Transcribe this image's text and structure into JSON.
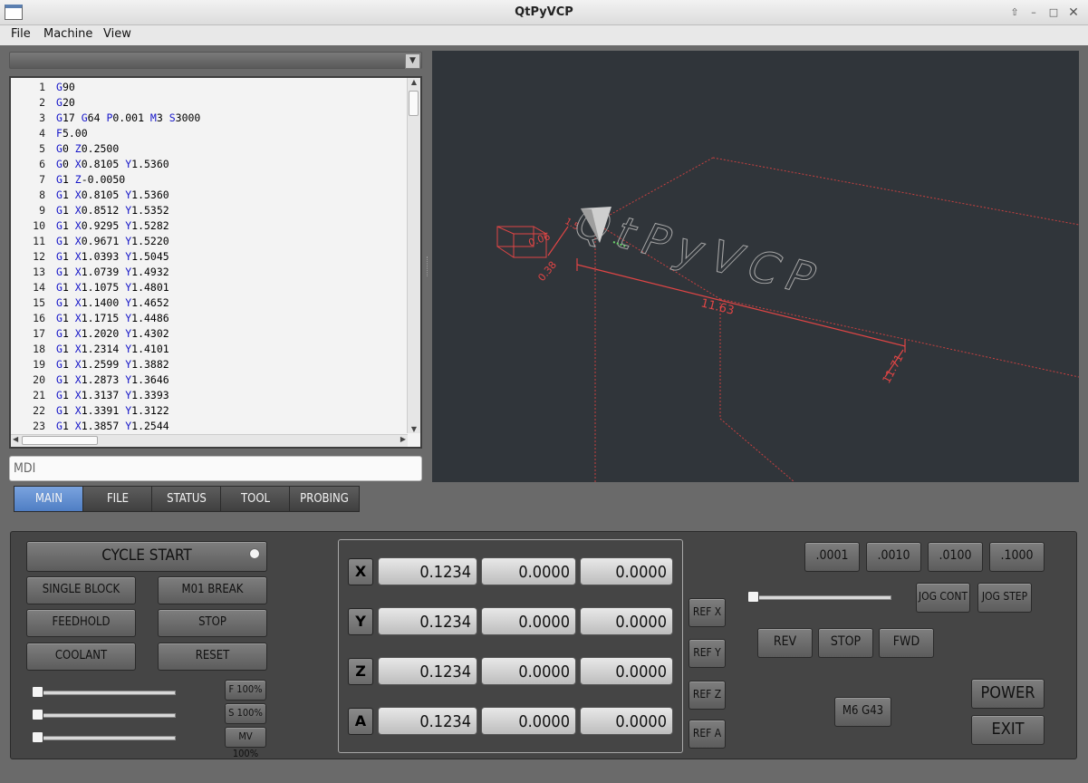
{
  "window": {
    "title": "QtPyVCP"
  },
  "menu": [
    "File",
    "Machine",
    "View"
  ],
  "program": {
    "lines": [
      {
        "n": "1",
        "parts": [
          [
            "k",
            "G"
          ],
          [
            "w",
            "90"
          ]
        ]
      },
      {
        "n": "2",
        "parts": [
          [
            "k",
            "G"
          ],
          [
            "w",
            "20"
          ]
        ]
      },
      {
        "n": "3",
        "parts": [
          [
            "k",
            "G"
          ],
          [
            "w",
            "17 "
          ],
          [
            "k",
            "G"
          ],
          [
            "w",
            "64 "
          ],
          [
            "k",
            "P"
          ],
          [
            "w",
            "0.001 "
          ],
          [
            "k",
            "M"
          ],
          [
            "w",
            "3 "
          ],
          [
            "k",
            "S"
          ],
          [
            "w",
            "3000"
          ]
        ]
      },
      {
        "n": "4",
        "parts": [
          [
            "k",
            "F"
          ],
          [
            "w",
            "5.00"
          ]
        ]
      },
      {
        "n": "5",
        "parts": [
          [
            "k",
            "G"
          ],
          [
            "w",
            "0 "
          ],
          [
            "k",
            "Z"
          ],
          [
            "w",
            "0.2500"
          ]
        ]
      },
      {
        "n": "6",
        "parts": [
          [
            "k",
            "G"
          ],
          [
            "w",
            "0 "
          ],
          [
            "k",
            "X"
          ],
          [
            "w",
            "0.8105 "
          ],
          [
            "k",
            "Y"
          ],
          [
            "w",
            "1.5360"
          ]
        ]
      },
      {
        "n": "7",
        "parts": [
          [
            "k",
            "G"
          ],
          [
            "w",
            "1 "
          ],
          [
            "k",
            "Z"
          ],
          [
            "w",
            "-0.0050"
          ]
        ]
      },
      {
        "n": "8",
        "parts": [
          [
            "k",
            "G"
          ],
          [
            "w",
            "1 "
          ],
          [
            "k",
            "X"
          ],
          [
            "w",
            "0.8105 "
          ],
          [
            "k",
            "Y"
          ],
          [
            "w",
            "1.5360"
          ]
        ]
      },
      {
        "n": "9",
        "parts": [
          [
            "k",
            "G"
          ],
          [
            "w",
            "1 "
          ],
          [
            "k",
            "X"
          ],
          [
            "w",
            "0.8512 "
          ],
          [
            "k",
            "Y"
          ],
          [
            "w",
            "1.5352"
          ]
        ]
      },
      {
        "n": "10",
        "parts": [
          [
            "k",
            "G"
          ],
          [
            "w",
            "1 "
          ],
          [
            "k",
            "X"
          ],
          [
            "w",
            "0.9295 "
          ],
          [
            "k",
            "Y"
          ],
          [
            "w",
            "1.5282"
          ]
        ]
      },
      {
        "n": "11",
        "parts": [
          [
            "k",
            "G"
          ],
          [
            "w",
            "1 "
          ],
          [
            "k",
            "X"
          ],
          [
            "w",
            "0.9671 "
          ],
          [
            "k",
            "Y"
          ],
          [
            "w",
            "1.5220"
          ]
        ]
      },
      {
        "n": "12",
        "parts": [
          [
            "k",
            "G"
          ],
          [
            "w",
            "1 "
          ],
          [
            "k",
            "X"
          ],
          [
            "w",
            "1.0393 "
          ],
          [
            "k",
            "Y"
          ],
          [
            "w",
            "1.5045"
          ]
        ]
      },
      {
        "n": "13",
        "parts": [
          [
            "k",
            "G"
          ],
          [
            "w",
            "1 "
          ],
          [
            "k",
            "X"
          ],
          [
            "w",
            "1.0739 "
          ],
          [
            "k",
            "Y"
          ],
          [
            "w",
            "1.4932"
          ]
        ]
      },
      {
        "n": "14",
        "parts": [
          [
            "k",
            "G"
          ],
          [
            "w",
            "1 "
          ],
          [
            "k",
            "X"
          ],
          [
            "w",
            "1.1075 "
          ],
          [
            "k",
            "Y"
          ],
          [
            "w",
            "1.4801"
          ]
        ]
      },
      {
        "n": "15",
        "parts": [
          [
            "k",
            "G"
          ],
          [
            "w",
            "1 "
          ],
          [
            "k",
            "X"
          ],
          [
            "w",
            "1.1400 "
          ],
          [
            "k",
            "Y"
          ],
          [
            "w",
            "1.4652"
          ]
        ]
      },
      {
        "n": "16",
        "parts": [
          [
            "k",
            "G"
          ],
          [
            "w",
            "1 "
          ],
          [
            "k",
            "X"
          ],
          [
            "w",
            "1.1715 "
          ],
          [
            "k",
            "Y"
          ],
          [
            "w",
            "1.4486"
          ]
        ]
      },
      {
        "n": "17",
        "parts": [
          [
            "k",
            "G"
          ],
          [
            "w",
            "1 "
          ],
          [
            "k",
            "X"
          ],
          [
            "w",
            "1.2020 "
          ],
          [
            "k",
            "Y"
          ],
          [
            "w",
            "1.4302"
          ]
        ]
      },
      {
        "n": "18",
        "parts": [
          [
            "k",
            "G"
          ],
          [
            "w",
            "1 "
          ],
          [
            "k",
            "X"
          ],
          [
            "w",
            "1.2314 "
          ],
          [
            "k",
            "Y"
          ],
          [
            "w",
            "1.4101"
          ]
        ]
      },
      {
        "n": "19",
        "parts": [
          [
            "k",
            "G"
          ],
          [
            "w",
            "1 "
          ],
          [
            "k",
            "X"
          ],
          [
            "w",
            "1.2599 "
          ],
          [
            "k",
            "Y"
          ],
          [
            "w",
            "1.3882"
          ]
        ]
      },
      {
        "n": "20",
        "parts": [
          [
            "k",
            "G"
          ],
          [
            "w",
            "1 "
          ],
          [
            "k",
            "X"
          ],
          [
            "w",
            "1.2873 "
          ],
          [
            "k",
            "Y"
          ],
          [
            "w",
            "1.3646"
          ]
        ]
      },
      {
        "n": "21",
        "parts": [
          [
            "k",
            "G"
          ],
          [
            "w",
            "1 "
          ],
          [
            "k",
            "X"
          ],
          [
            "w",
            "1.3137 "
          ],
          [
            "k",
            "Y"
          ],
          [
            "w",
            "1.3393"
          ]
        ]
      },
      {
        "n": "22",
        "parts": [
          [
            "k",
            "G"
          ],
          [
            "w",
            "1 "
          ],
          [
            "k",
            "X"
          ],
          [
            "w",
            "1.3391 "
          ],
          [
            "k",
            "Y"
          ],
          [
            "w",
            "1.3122"
          ]
        ]
      },
      {
        "n": "23",
        "parts": [
          [
            "k",
            "G"
          ],
          [
            "w",
            "1 "
          ],
          [
            "k",
            "X"
          ],
          [
            "w",
            "1.3857 "
          ],
          [
            "k",
            "Y"
          ],
          [
            "w",
            "1.2544"
          ]
        ]
      }
    ]
  },
  "mdi": {
    "placeholder": "MDI"
  },
  "backplot": {
    "watermark": "QtPyVCP",
    "dims": {
      "x_len": "11.63",
      "y_len": "11.71",
      "left_a": "0.38",
      "left_b": "1.5",
      "left_c": "0.06"
    },
    "colors": {
      "bg": "#30353a",
      "limits": "#d23a3a",
      "text_outline": "#9a9a9a",
      "tool": "#cfcfcf"
    }
  },
  "tabs": [
    {
      "label": "MAIN",
      "selected": true
    },
    {
      "label": "FILE",
      "selected": false
    },
    {
      "label": "STATUS",
      "selected": false
    },
    {
      "label": "TOOL",
      "selected": false
    },
    {
      "label": "PROBING",
      "selected": false
    }
  ],
  "controls": {
    "cycle_start": "CYCLE START",
    "single_block": "SINGLE BLOCK",
    "m01_break": "M01 BREAK",
    "feedhold": "FEEDHOLD",
    "stop": "STOP",
    "coolant": "COOLANT",
    "reset": "RESET",
    "feed_override": "F 100%",
    "spindle_override": "S 100%",
    "max_velocity": "MV 100%",
    "feed_override_value": 0,
    "spindle_override_value": 0,
    "max_velocity_value": 0
  },
  "dro": [
    {
      "axis": "X",
      "values": [
        "0.1234",
        "0.0000",
        "0.0000"
      ],
      "ref": "REF X"
    },
    {
      "axis": "Y",
      "values": [
        "0.1234",
        "0.0000",
        "0.0000"
      ],
      "ref": "REF Y"
    },
    {
      "axis": "Z",
      "values": [
        "0.1234",
        "0.0000",
        "0.0000"
      ],
      "ref": "REF Z"
    },
    {
      "axis": "A",
      "values": [
        "0.1234",
        "0.0000",
        "0.0000"
      ],
      "ref": "REF A"
    }
  ],
  "jog": {
    "increments": [
      ".0001",
      ".0010",
      ".0100",
      ".1000"
    ],
    "jog_cont": "JOG CONT",
    "jog_step": "JOG STEP",
    "jog_speed_value": 0,
    "rev": "REV",
    "stop": "STOP",
    "fwd": "FWD",
    "m6g43": "M6 G43",
    "power": "POWER",
    "exit": "EXIT"
  }
}
